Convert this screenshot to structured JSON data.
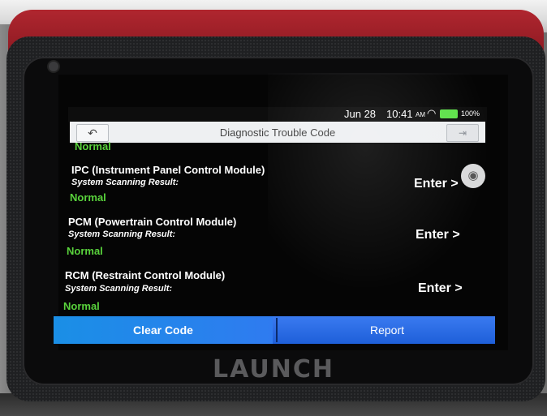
{
  "status_bar": {
    "date": "Jun 28",
    "time": "10:41",
    "ampm": "AM",
    "battery": "100%",
    "wifi_icon": "wifi-icon"
  },
  "header": {
    "title": "Diagnostic Trouble Code",
    "back_icon": "back-arrow-icon",
    "exit_icon": "exit-icon"
  },
  "list": {
    "top_status": "Normal",
    "modules": [
      {
        "name": "IPC (Instrument Panel Control Module)",
        "scan_label": "System Scanning Result:",
        "result": "Normal",
        "action": "Enter >"
      },
      {
        "name": "PCM (Powertrain Control Module)",
        "scan_label": "System Scanning Result:",
        "result": "Normal",
        "action": "Enter >"
      },
      {
        "name": "RCM (Restraint Control Module)",
        "scan_label": "System Scanning Result:",
        "result": "Normal",
        "action": "Enter >"
      }
    ]
  },
  "actions": {
    "clear_code": "Clear Code",
    "report": "Report"
  },
  "brand": "LAUNCH",
  "colors": {
    "status_ok": "#59d23c",
    "button_blue": "#2f7bf0",
    "device_red": "#b0262f"
  }
}
